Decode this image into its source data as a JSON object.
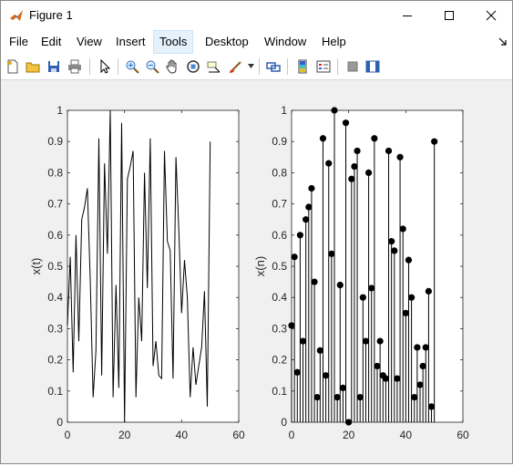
{
  "window": {
    "title": "Figure 1",
    "app_icon": "matlab-icon",
    "controls": [
      "minimize-icon",
      "maximize-icon",
      "close-icon"
    ]
  },
  "menu": {
    "items": [
      "File",
      "Edit",
      "View",
      "Insert",
      "Tools",
      "Desktop",
      "Window",
      "Help"
    ],
    "active": "Tools"
  },
  "toolbar": {
    "icons": [
      "new-figure-icon",
      "open-file-icon",
      "save-icon",
      "print-icon",
      "select-arrow-icon",
      "zoom-in-icon",
      "zoom-out-icon",
      "pan-hand-icon",
      "rotate-3d-icon",
      "data-cursor-icon",
      "brush-icon",
      "link-plot-icon",
      "colorbar-icon",
      "legend-icon",
      "hide-plot-tools-icon",
      "show-plot-tools-icon"
    ]
  },
  "colors": {
    "plot_background": "#ffffff",
    "figure_background": "#f0f0f0",
    "line": "#000000",
    "active_menu": "#e5f1fb"
  },
  "chart_data": [
    {
      "type": "line",
      "ylabel": "x(t)",
      "xlim": [
        0,
        60
      ],
      "ylim": [
        0,
        1
      ],
      "xticks": [
        0,
        20,
        40,
        60
      ],
      "yticks": [
        0,
        0.1,
        0.2,
        0.3,
        0.4,
        0.5,
        0.6,
        0.7,
        0.8,
        0.9,
        1
      ],
      "grid": false,
      "x": [
        0,
        1,
        2,
        3,
        4,
        5,
        6,
        7,
        8,
        9,
        10,
        11,
        12,
        13,
        14,
        15,
        16,
        17,
        18,
        19,
        20,
        21,
        22,
        23,
        24,
        25,
        26,
        27,
        28,
        29,
        30,
        31,
        32,
        33,
        34,
        35,
        36,
        37,
        38,
        39,
        40,
        41,
        42,
        43,
        44,
        45,
        46,
        47,
        48,
        49,
        50
      ],
      "values": [
        0.31,
        0.53,
        0.16,
        0.6,
        0.26,
        0.65,
        0.69,
        0.75,
        0.45,
        0.08,
        0.23,
        0.91,
        0.15,
        0.83,
        0.54,
        1.0,
        0.08,
        0.44,
        0.11,
        0.96,
        0.0,
        0.78,
        0.82,
        0.87,
        0.08,
        0.4,
        0.26,
        0.8,
        0.43,
        0.91,
        0.18,
        0.26,
        0.15,
        0.14,
        0.87,
        0.58,
        0.55,
        0.14,
        0.85,
        0.62,
        0.35,
        0.52,
        0.4,
        0.08,
        0.24,
        0.12,
        0.18,
        0.24,
        0.42,
        0.05,
        0.9
      ]
    },
    {
      "type": "stem",
      "ylabel": "x(n)",
      "xlim": [
        0,
        60
      ],
      "ylim": [
        0,
        1
      ],
      "xticks": [
        0,
        20,
        40,
        60
      ],
      "yticks": [
        0,
        0.1,
        0.2,
        0.3,
        0.4,
        0.5,
        0.6,
        0.7,
        0.8,
        0.9,
        1
      ],
      "grid": false,
      "x": [
        0,
        1,
        2,
        3,
        4,
        5,
        6,
        7,
        8,
        9,
        10,
        11,
        12,
        13,
        14,
        15,
        16,
        17,
        18,
        19,
        20,
        21,
        22,
        23,
        24,
        25,
        26,
        27,
        28,
        29,
        30,
        31,
        32,
        33,
        34,
        35,
        36,
        37,
        38,
        39,
        40,
        41,
        42,
        43,
        44,
        45,
        46,
        47,
        48,
        49,
        50
      ],
      "values": [
        0.31,
        0.53,
        0.16,
        0.6,
        0.26,
        0.65,
        0.69,
        0.75,
        0.45,
        0.08,
        0.23,
        0.91,
        0.15,
        0.83,
        0.54,
        1.0,
        0.08,
        0.44,
        0.11,
        0.96,
        0.0,
        0.78,
        0.82,
        0.87,
        0.08,
        0.4,
        0.26,
        0.8,
        0.43,
        0.91,
        0.18,
        0.26,
        0.15,
        0.14,
        0.87,
        0.58,
        0.55,
        0.14,
        0.85,
        0.62,
        0.35,
        0.52,
        0.4,
        0.08,
        0.24,
        0.12,
        0.18,
        0.24,
        0.42,
        0.05,
        0.9
      ]
    }
  ]
}
